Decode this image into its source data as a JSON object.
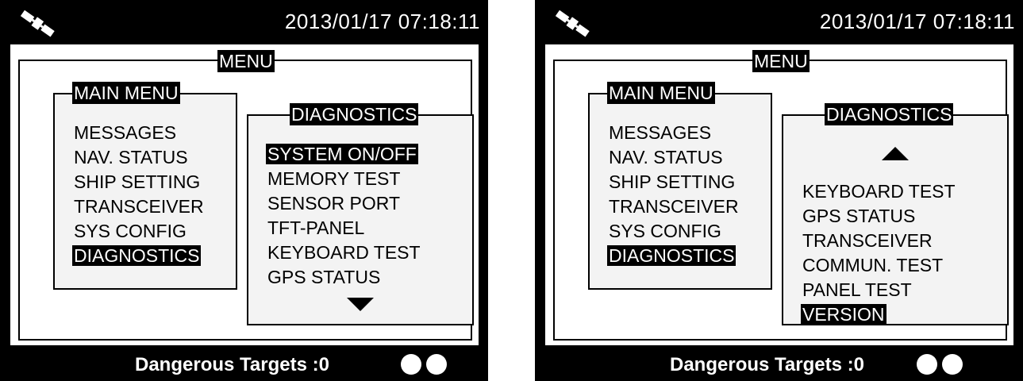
{
  "screens": [
    {
      "datetime": "2013/01/17 07:18:11",
      "menu_title": "MENU",
      "main_menu": {
        "title": "MAIN MENU",
        "items": [
          "MESSAGES",
          "NAV. STATUS",
          "SHIP SETTING",
          "TRANSCEIVER",
          "SYS CONFIG",
          "DIAGNOSTICS"
        ],
        "selected": "DIAGNOSTICS"
      },
      "diagnostics": {
        "title": "DIAGNOSTICS",
        "items": [
          "SYSTEM ON/OFF",
          "MEMORY TEST",
          "SENSOR PORT",
          "TFT-PANEL",
          "KEYBOARD TEST",
          "GPS STATUS"
        ],
        "selected": "SYSTEM ON/OFF",
        "scroll_indicator": "down-arrow-icon"
      },
      "footer": {
        "dangerous_targets": "Dangerous Targets :0",
        "status_dots": 2
      }
    },
    {
      "datetime": "2013/01/17 07:18:11",
      "menu_title": "MENU",
      "main_menu": {
        "title": "MAIN MENU",
        "items": [
          "MESSAGES",
          "NAV. STATUS",
          "SHIP SETTING",
          "TRANSCEIVER",
          "SYS CONFIG",
          "DIAGNOSTICS"
        ],
        "selected": "DIAGNOSTICS"
      },
      "diagnostics": {
        "title": "DIAGNOSTICS",
        "items": [
          "KEYBOARD TEST",
          "GPS STATUS",
          "TRANSCEIVER",
          "COMMUN. TEST",
          "PANEL TEST",
          "VERSION"
        ],
        "selected": "VERSION",
        "scroll_indicator": "up-arrow-icon"
      },
      "footer": {
        "dangerous_targets": "Dangerous Targets :0",
        "status_dots": 2
      }
    }
  ]
}
